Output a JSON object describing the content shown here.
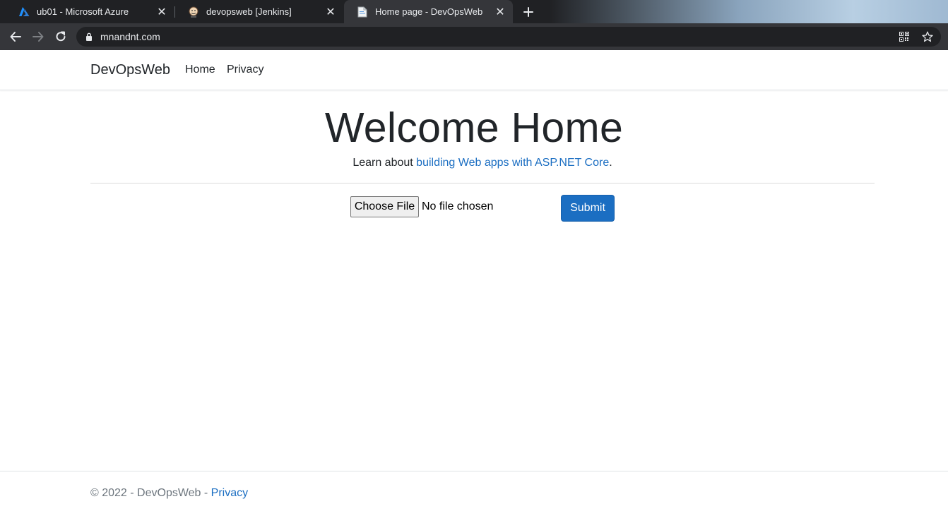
{
  "browser": {
    "tabs": [
      {
        "title": "ub01 - Microsoft Azure",
        "icon": "azure-icon",
        "active": false
      },
      {
        "title": "devopsweb [Jenkins]",
        "icon": "jenkins-icon",
        "active": false
      },
      {
        "title": "Home page - DevOpsWeb",
        "icon": "page-icon",
        "active": true
      }
    ],
    "url": "mnandnt.com"
  },
  "site": {
    "brand": "DevOpsWeb",
    "nav": [
      {
        "label": "Home"
      },
      {
        "label": "Privacy"
      }
    ],
    "heading": "Welcome Home",
    "lead_prefix": "Learn about ",
    "lead_link": "building Web apps with ASP.NET Core",
    "lead_suffix": ".",
    "file_button": "Choose File",
    "file_status": "No file chosen",
    "submit": "Submit",
    "footer_text": "© 2022 - DevOpsWeb - ",
    "footer_link": "Privacy"
  },
  "colors": {
    "accent": "#1b6ec2",
    "chrome_dark": "#202124",
    "chrome_toolbar": "#35363a"
  }
}
